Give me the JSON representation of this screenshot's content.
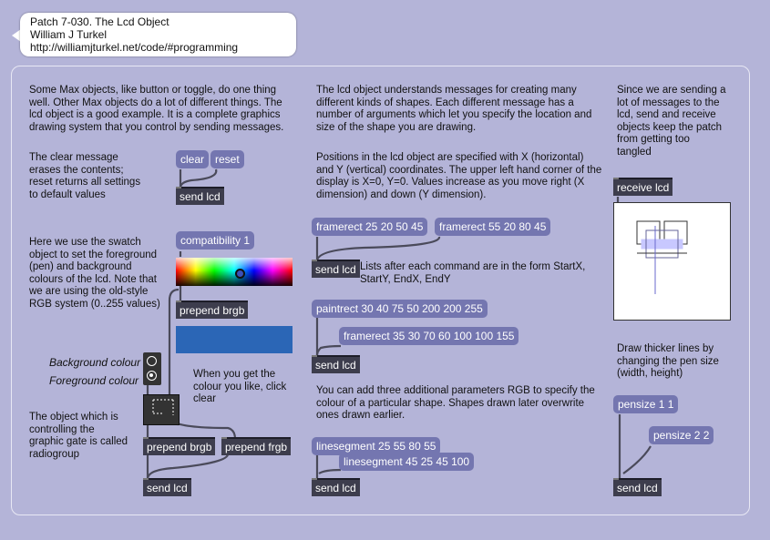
{
  "header": {
    "title": "Patch 7-030. The Lcd Object",
    "author": "William J Turkel",
    "url": "http://williamjturkel.net/code/#programming"
  },
  "comments": {
    "intro": "Some Max objects, like button or toggle, do one thing well. Other Max objects do a lot of different things. The lcd object is a good example. It is a complete graphics drawing system that you control by sending messages.",
    "clear_reset": "The clear message erases the contents; reset returns all settings to default values",
    "swatch": "Here we use the swatch object to set the foreground (pen) and background colours of the lcd. Note that we are using the old-style RGB system (0..255 values)",
    "background_colour": "Background colour",
    "foreground_colour": "Foreground colour",
    "when_colour": "When you get the colour you like, click clear",
    "radiogroup": "The object which is controlling the graphic gate is called radiogroup",
    "messages": "The lcd object understands messages for creating many different kinds of shapes. Each different message has a number of arguments which let you specify the location and size of the shape you are drawing.",
    "positions": "Positions in the lcd object are specified with X (horizontal) and Y (vertical) coordinates. The upper left hand corner of the display is X=0, Y=0. Values increase as you move right (X dimension) and down (Y dimension).",
    "lists": "Lists after each command are in the form StartX, StartY, EndX, EndY",
    "rgb": "You can add three additional parameters RGB to specify the colour of a particular shape. Shapes drawn later overwrite ones drawn earlier.",
    "send_receive": "Since we are sending a lot of messages to the lcd, send and receive objects keep the patch from getting too tangled",
    "thicker": "Draw thicker lines by changing the pen size (width, height)"
  },
  "boxes": {
    "clear": "clear",
    "reset": "reset",
    "send_lcd": "send lcd",
    "compatibility": "compatibility 1",
    "prepend_brgb_top": "prepend brgb",
    "prepend_brgb": "prepend brgb",
    "prepend_frgb": "prepend frgb",
    "framerect1": "framerect 25 20 50 45",
    "framerect2": "framerect 55 20 80 45",
    "paintrect": "paintrect 30 40 75 50 200 200 255",
    "framerect3": "framerect 35 30 70 60 100 100 155",
    "linesegment1": "linesegment 25 55 80 55",
    "linesegment2": "linesegment 45 25 45 100",
    "receive_lcd": "receive lcd",
    "pensize1": "pensize 1 1",
    "pensize2": "pensize 2 2"
  },
  "colors": {
    "background": "#b4b4d8",
    "message_box": "#7476b0",
    "object_box": "#3d3d4d",
    "swatch_selected": "#2b66b6"
  }
}
